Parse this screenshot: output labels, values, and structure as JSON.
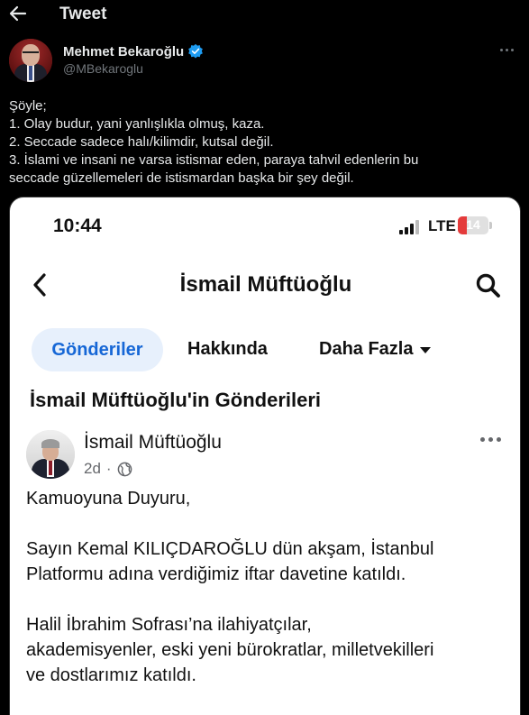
{
  "header": {
    "back_icon": "arrow-left-icon",
    "title": "Tweet"
  },
  "author": {
    "name": "Mehmet Bekaroğlu",
    "handle": "@MBekaroglu",
    "verified_color": "#1d9bf0"
  },
  "tweet": {
    "lines": [
      "Şöyle;",
      "1. Olay budur, yani yanlışlıkla olmuş, kaza.",
      "2. Seccade sadece halı/kilimdir, kutsal değil.",
      "3. İslami ve insani ne varsa istismar eden, paraya tahvil edenlerin bu",
      "seccade güzellemeleri de istismardan başka bir şey değil."
    ]
  },
  "screenshot": {
    "status": {
      "time": "10:44",
      "network": "LTE",
      "battery": "14",
      "battery_level": 0.14,
      "battery_color": "#e43b3b"
    },
    "page_title": "İsmail Müftüoğlu",
    "tabs": {
      "posts": "Gönderiler",
      "about": "Hakkında",
      "more": "Daha Fazla"
    },
    "section_title": "İsmail Müftüoğlu'in Gönderileri",
    "post": {
      "author": "İsmail Müftüoğlu",
      "time": "2d",
      "separator": "·",
      "paragraphs": [
        [
          "Kamuoyuna Duyuru,"
        ],
        [
          "Sayın Kemal KILIÇDAROĞLU dün akşam, İstanbul",
          "Platformu adına verdiğimiz iftar davetine katıldı."
        ],
        [
          "Halil İbrahim Sofrası’na ilahiyatçılar,",
          "akademisyenler, eski yeni bürokratlar, milletvekilleri",
          "ve dostlarımız katıldı."
        ]
      ]
    },
    "accent_color": "#1667d6"
  }
}
